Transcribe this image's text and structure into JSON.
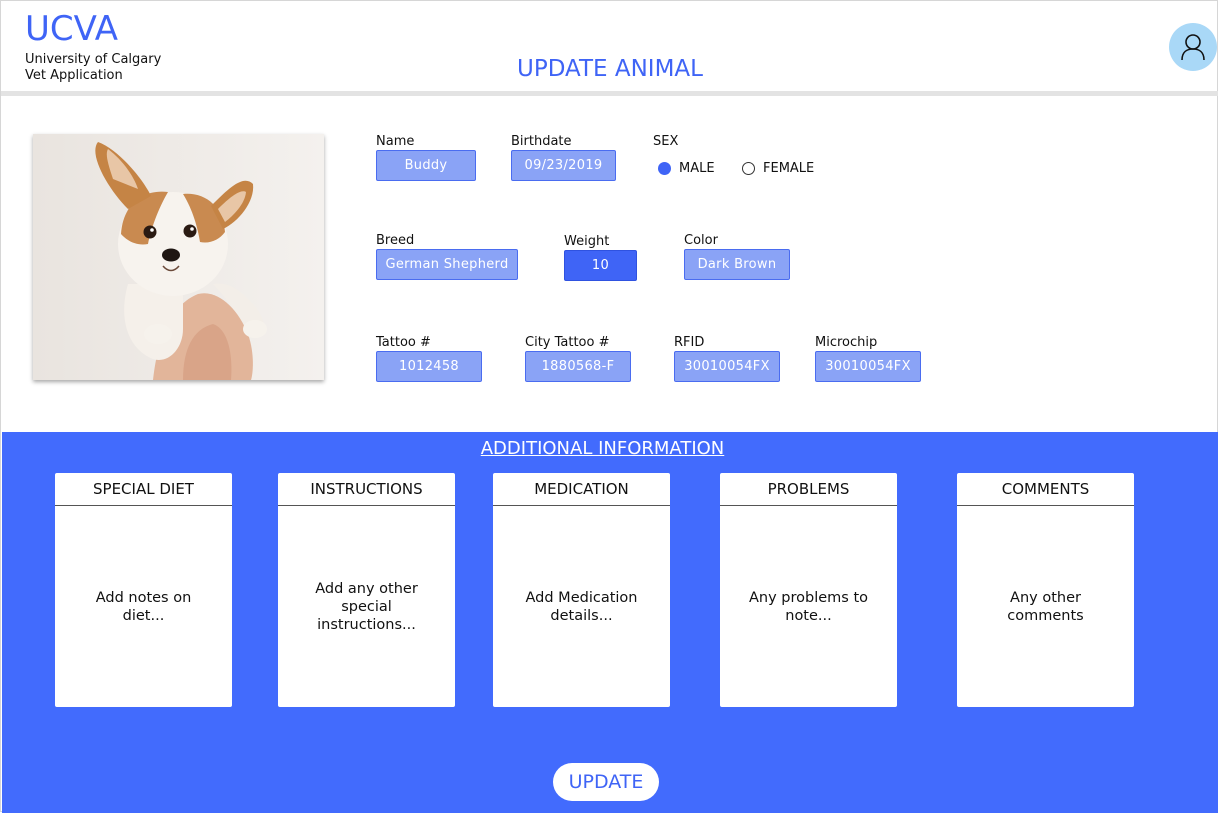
{
  "header": {
    "logo": "UCVA",
    "subtitle_line1": "University of Calgary",
    "subtitle_line2": "Vet Application",
    "page_title": "UPDATE ANIMAL",
    "avatar_icon": "user-icon"
  },
  "animal": {
    "photo_icon": "puppy-photo",
    "name_label": "Name",
    "name_value": "Buddy",
    "birthdate_label": "Birthdate",
    "birthdate_value": "09/23/2019",
    "sex_label": "SEX",
    "sex_options": [
      "MALE",
      "FEMALE"
    ],
    "sex_selected": "MALE",
    "breed_label": "Breed",
    "breed_value": "German Shepherd",
    "weight_label": "Weight",
    "weight_value": "10",
    "color_label": "Color",
    "color_value": "Dark Brown",
    "tattoo_label": "Tattoo #",
    "tattoo_value": "1012458",
    "city_tattoo_label": "City Tattoo #",
    "city_tattoo_value": "1880568-F",
    "rfid_label": "RFID",
    "rfid_value": "30010054FX",
    "microchip_label": "Microchip",
    "microchip_value": "30010054FX"
  },
  "additional": {
    "title": "ADDITIONAL INFORMATION",
    "cards": [
      {
        "title": "SPECIAL DIET",
        "placeholder": "Add notes on diet..."
      },
      {
        "title": "INSTRUCTIONS",
        "placeholder": "Add any other special instructions..."
      },
      {
        "title": "MEDICATION",
        "placeholder": "Add Medication details..."
      },
      {
        "title": "PROBLEMS",
        "placeholder": "Any problems to note..."
      },
      {
        "title": "COMMENTS",
        "placeholder": "Any other comments"
      }
    ]
  },
  "actions": {
    "update_label": "UPDATE"
  },
  "colors": {
    "accent": "#3f64f6",
    "field_bg": "#8aa3f6",
    "section_bg": "#426bfd",
    "avatar_bg": "#a9d8f7"
  }
}
